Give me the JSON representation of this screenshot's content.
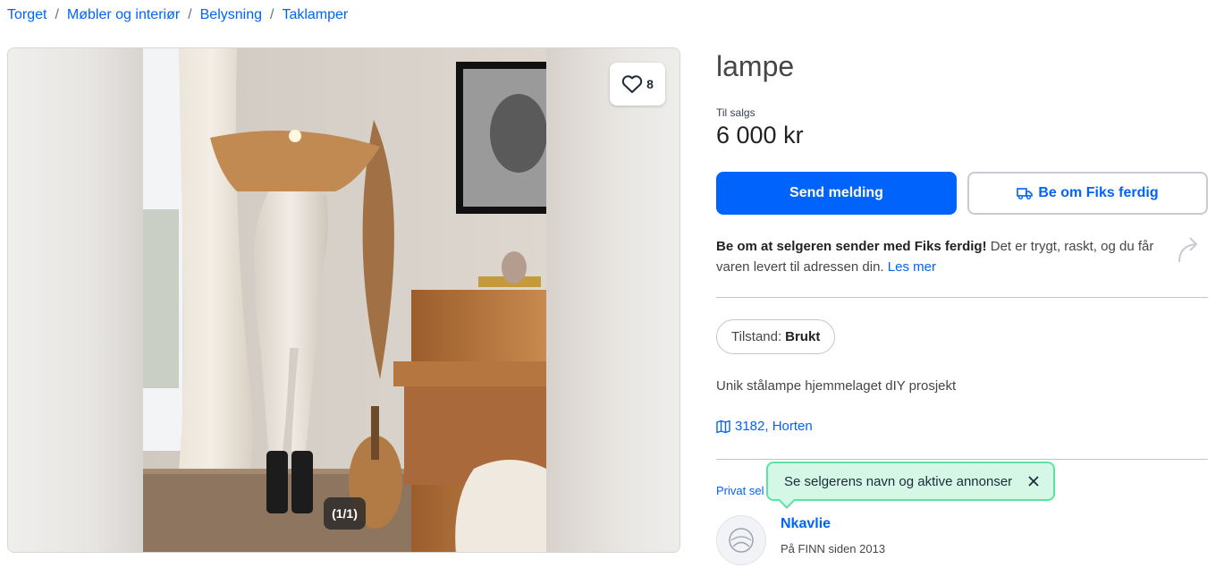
{
  "breadcrumb": [
    "Torget",
    "Møbler og interiør",
    "Belysning",
    "Taklamper"
  ],
  "gallery": {
    "favorite_count": "8",
    "image_counter": "(1/1)"
  },
  "listing": {
    "title": "lampe",
    "sale_label": "Til salgs",
    "price": "6 000 kr",
    "send_message_label": "Send melding",
    "fiks_button_label": "Be om Fiks ferdig",
    "fiks_info_bold": "Be om at selgeren sender med Fiks ferdig!",
    "fiks_info_text": " Det er trygt, raskt, og du får varen levert til adressen din. ",
    "fiks_info_link": "Les mer",
    "condition_label": "Tilstand:",
    "condition_value": "Brukt",
    "description": "Unik stålampe hjemmelaget dIY prosjekt",
    "location": "3182, Horten"
  },
  "seller": {
    "type_label": "Privat sel",
    "tooltip": "Se selgerens navn og aktive annonser",
    "name": "Nkavlie",
    "since": "På FINN siden 2013"
  },
  "colors": {
    "accent": "#0063fb",
    "tooltip_bg": "#d5f8e6",
    "tooltip_border": "#5ce2a3"
  },
  "icons": [
    "heart-icon",
    "truck-icon",
    "share-icon",
    "map-icon",
    "close-icon",
    "avatar-placeholder-icon"
  ]
}
